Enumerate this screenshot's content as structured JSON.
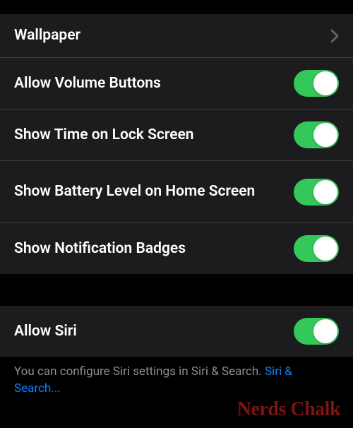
{
  "section1": {
    "wallpaper": {
      "label": "Wallpaper"
    },
    "volume_buttons": {
      "label": "Allow Volume Buttons",
      "enabled": true
    },
    "show_time": {
      "label": "Show Time on Lock Screen",
      "enabled": true
    },
    "battery_level": {
      "label": "Show Battery Level on Home Screen",
      "enabled": true
    },
    "notification_badges": {
      "label": "Show Notification Badges",
      "enabled": true
    }
  },
  "section2": {
    "allow_siri": {
      "label": "Allow Siri",
      "enabled": true
    },
    "footer_prefix": "You can configure Siri settings in Siri & Search. ",
    "footer_link": "Siri & Search..."
  },
  "watermark": "Nerds Chalk"
}
